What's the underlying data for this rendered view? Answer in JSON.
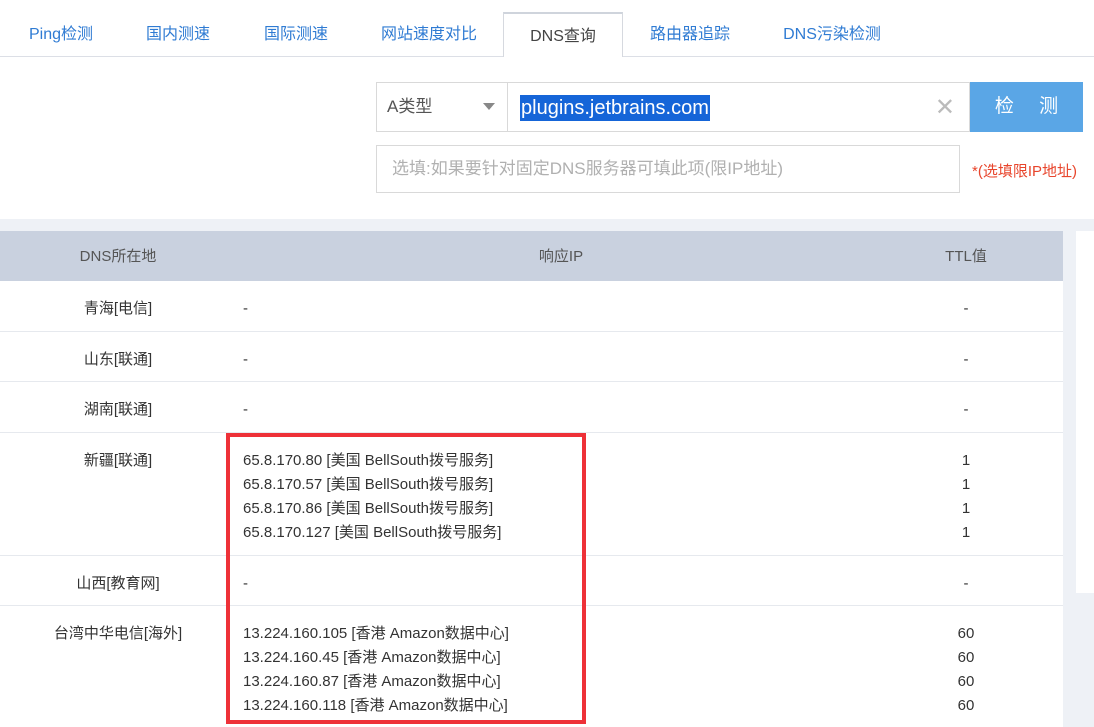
{
  "tabs": [
    {
      "label": "Ping检测"
    },
    {
      "label": "国内测速"
    },
    {
      "label": "国际测速"
    },
    {
      "label": "网站速度对比"
    },
    {
      "label": "DNS查询"
    },
    {
      "label": "路由器追踪"
    },
    {
      "label": "DNS污染检测"
    }
  ],
  "active_tab": "DNS查询",
  "form": {
    "record_type": "A类型",
    "domain_value": "plugins.jetbrains.com",
    "clear_icon": "close-icon",
    "check_button": "检 测",
    "dns_server_placeholder": "选填:如果要针对固定DNS服务器可填此项(限IP地址)",
    "dns_server_hint": "*(选填限IP地址)"
  },
  "table": {
    "headers": {
      "location": "DNS所在地",
      "ip": "响应IP",
      "ttl": "TTL值"
    },
    "rows": [
      {
        "location": "青海[电信]",
        "ips": [
          "-"
        ],
        "ttls": [
          "-"
        ]
      },
      {
        "location": "山东[联通]",
        "ips": [
          "-"
        ],
        "ttls": [
          "-"
        ]
      },
      {
        "location": "湖南[联通]",
        "ips": [
          "-"
        ],
        "ttls": [
          "-"
        ]
      },
      {
        "location": "新疆[联通]",
        "ips": [
          "65.8.170.80 [美国 BellSouth拨号服务]",
          "65.8.170.57 [美国 BellSouth拨号服务]",
          "65.8.170.86 [美国 BellSouth拨号服务]",
          "65.8.170.127 [美国 BellSouth拨号服务]"
        ],
        "ttls": [
          "1",
          "1",
          "1",
          "1"
        ]
      },
      {
        "location": "山西[教育网]",
        "ips": [
          "-"
        ],
        "ttls": [
          "-"
        ]
      },
      {
        "location": "台湾中华电信[海外]",
        "ips": [
          "13.224.160.105 [香港 Amazon数据中心]",
          "13.224.160.45 [香港 Amazon数据中心]",
          "13.224.160.87 [香港 Amazon数据中心]",
          "13.224.160.118 [香港 Amazon数据中心]"
        ],
        "ttls": [
          "60",
          "60",
          "60",
          "60"
        ]
      }
    ]
  },
  "colors": {
    "tab_link": "#2f7bd3",
    "button": "#5aa6e6",
    "header_bg": "#c9d1df",
    "highlight_border": "#ee3138",
    "hint": "#e8452c",
    "selection": "#1565d8"
  }
}
